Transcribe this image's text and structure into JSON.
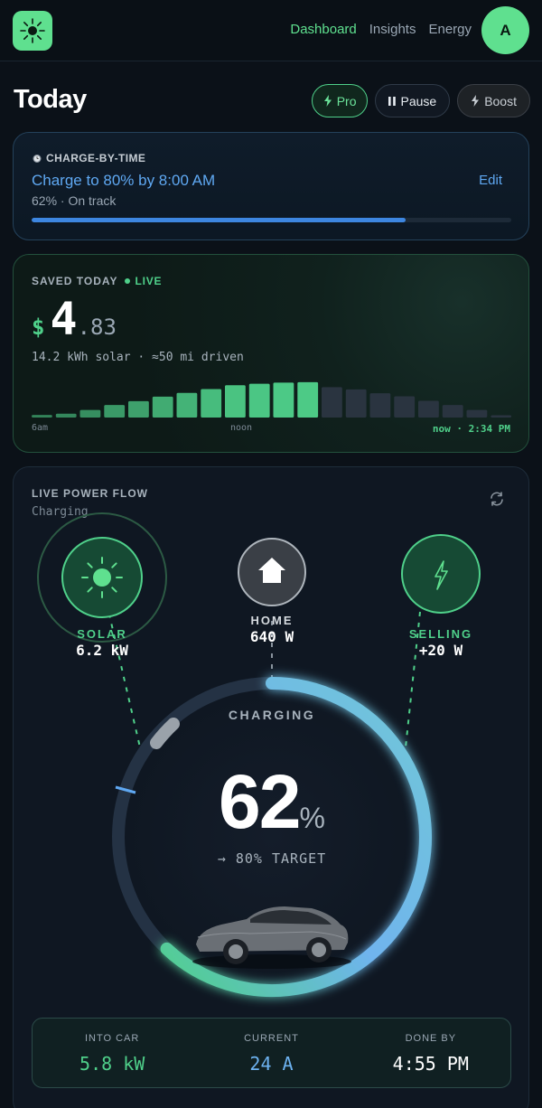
{
  "nav": {
    "links": [
      "Dashboard",
      "Insights",
      "Energy"
    ],
    "active": "Dashboard",
    "avatar_initial": "A",
    "logo_icon": "sun-icon"
  },
  "header": {
    "title": "Today",
    "pro_label": "Pro",
    "pause_label": "Pause",
    "boost_label": "Boost"
  },
  "charge_by_time": {
    "label": "CHARGE-BY-TIME",
    "title": "Charge to 80% by 8:00 AM",
    "status": "62% · On track",
    "edit_label": "Edit",
    "progress": 0.78
  },
  "saved_today": {
    "label": "SAVED TODAY",
    "live_label": "LIVE",
    "currency": "$",
    "amount_int": "4",
    "amount_dec": ".83",
    "subtitle": "14.2 kWh solar · ≈50 mi driven",
    "x_labels": [
      "6am",
      "noon"
    ],
    "now_label": "now · 2:34 PM",
    "bars": [
      0.07,
      0.1,
      0.2,
      0.33,
      0.43,
      0.55,
      0.65,
      0.75,
      0.85,
      0.89,
      0.92,
      0.93,
      0.8,
      0.74,
      0.64,
      0.56,
      0.44,
      0.33,
      0.2,
      0.06
    ],
    "past_bar_count": 12,
    "colors": {
      "accent": "#4fd08a",
      "future": "#2a3440"
    }
  },
  "power_flow": {
    "label": "LIVE POWER FLOW",
    "status": "Charging",
    "solar": {
      "label": "SOLAR",
      "value": "6.2 kW"
    },
    "home": {
      "label": "HOME",
      "value": "640 W"
    },
    "selling": {
      "label": "SELLING",
      "value": "+20 W"
    },
    "ring_label": "CHARGING",
    "percent": "62",
    "percent_sym": "%",
    "target_text": "→ 80% TARGET",
    "charge_fraction": 0.62
  },
  "stats": [
    {
      "label": "INTO CAR",
      "value": "5.8 kW"
    },
    {
      "label": "CURRENT",
      "value": "24 A"
    },
    {
      "label": "DONE BY",
      "value": "4:55 PM"
    }
  ]
}
